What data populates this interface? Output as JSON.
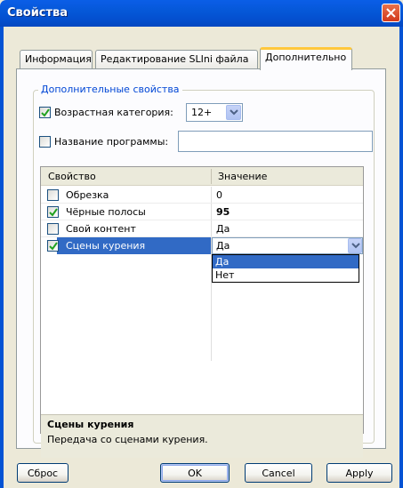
{
  "window": {
    "title": "Свойства"
  },
  "tabs": [
    {
      "label": "Информация",
      "active": false
    },
    {
      "label": "Редактирование SLIni файла",
      "active": false
    },
    {
      "label": "Дополнительно",
      "active": true
    }
  ],
  "group": {
    "legend": "Дополнительные свойства",
    "age_checkbox": {
      "label": "Возрастная категория:",
      "checked": true
    },
    "age_combo": {
      "value": "12+"
    },
    "program_checkbox": {
      "label": "Название программы:",
      "checked": false
    },
    "program_input": {
      "value": ""
    }
  },
  "grid": {
    "columns": [
      "Свойство",
      "Значение"
    ],
    "rows": [
      {
        "name": "Обрезка",
        "value": "0",
        "checked": false,
        "bold_value": false
      },
      {
        "name": "Чёрные полосы",
        "value": "95",
        "checked": true,
        "bold_value": true
      },
      {
        "name": "Свой контент",
        "value": "Да",
        "checked": false,
        "bold_value": false
      },
      {
        "name": "Сцены курения",
        "value": "Да",
        "checked": true,
        "bold_value": false,
        "selected": true
      }
    ],
    "dropdown_options": [
      "Да",
      "Нет"
    ],
    "dropdown_highlight": "Да",
    "description": {
      "title": "Сцены курения",
      "text": "Передача со сценами курения."
    }
  },
  "buttons": {
    "reset": "Сброс",
    "ok": "OK",
    "cancel": "Cancel",
    "apply": "Apply"
  },
  "colors": {
    "titlebar": "#0453d4",
    "selection": "#316ac5",
    "tab_highlight": "#ffc83c",
    "legend_text": "#0046d5"
  }
}
